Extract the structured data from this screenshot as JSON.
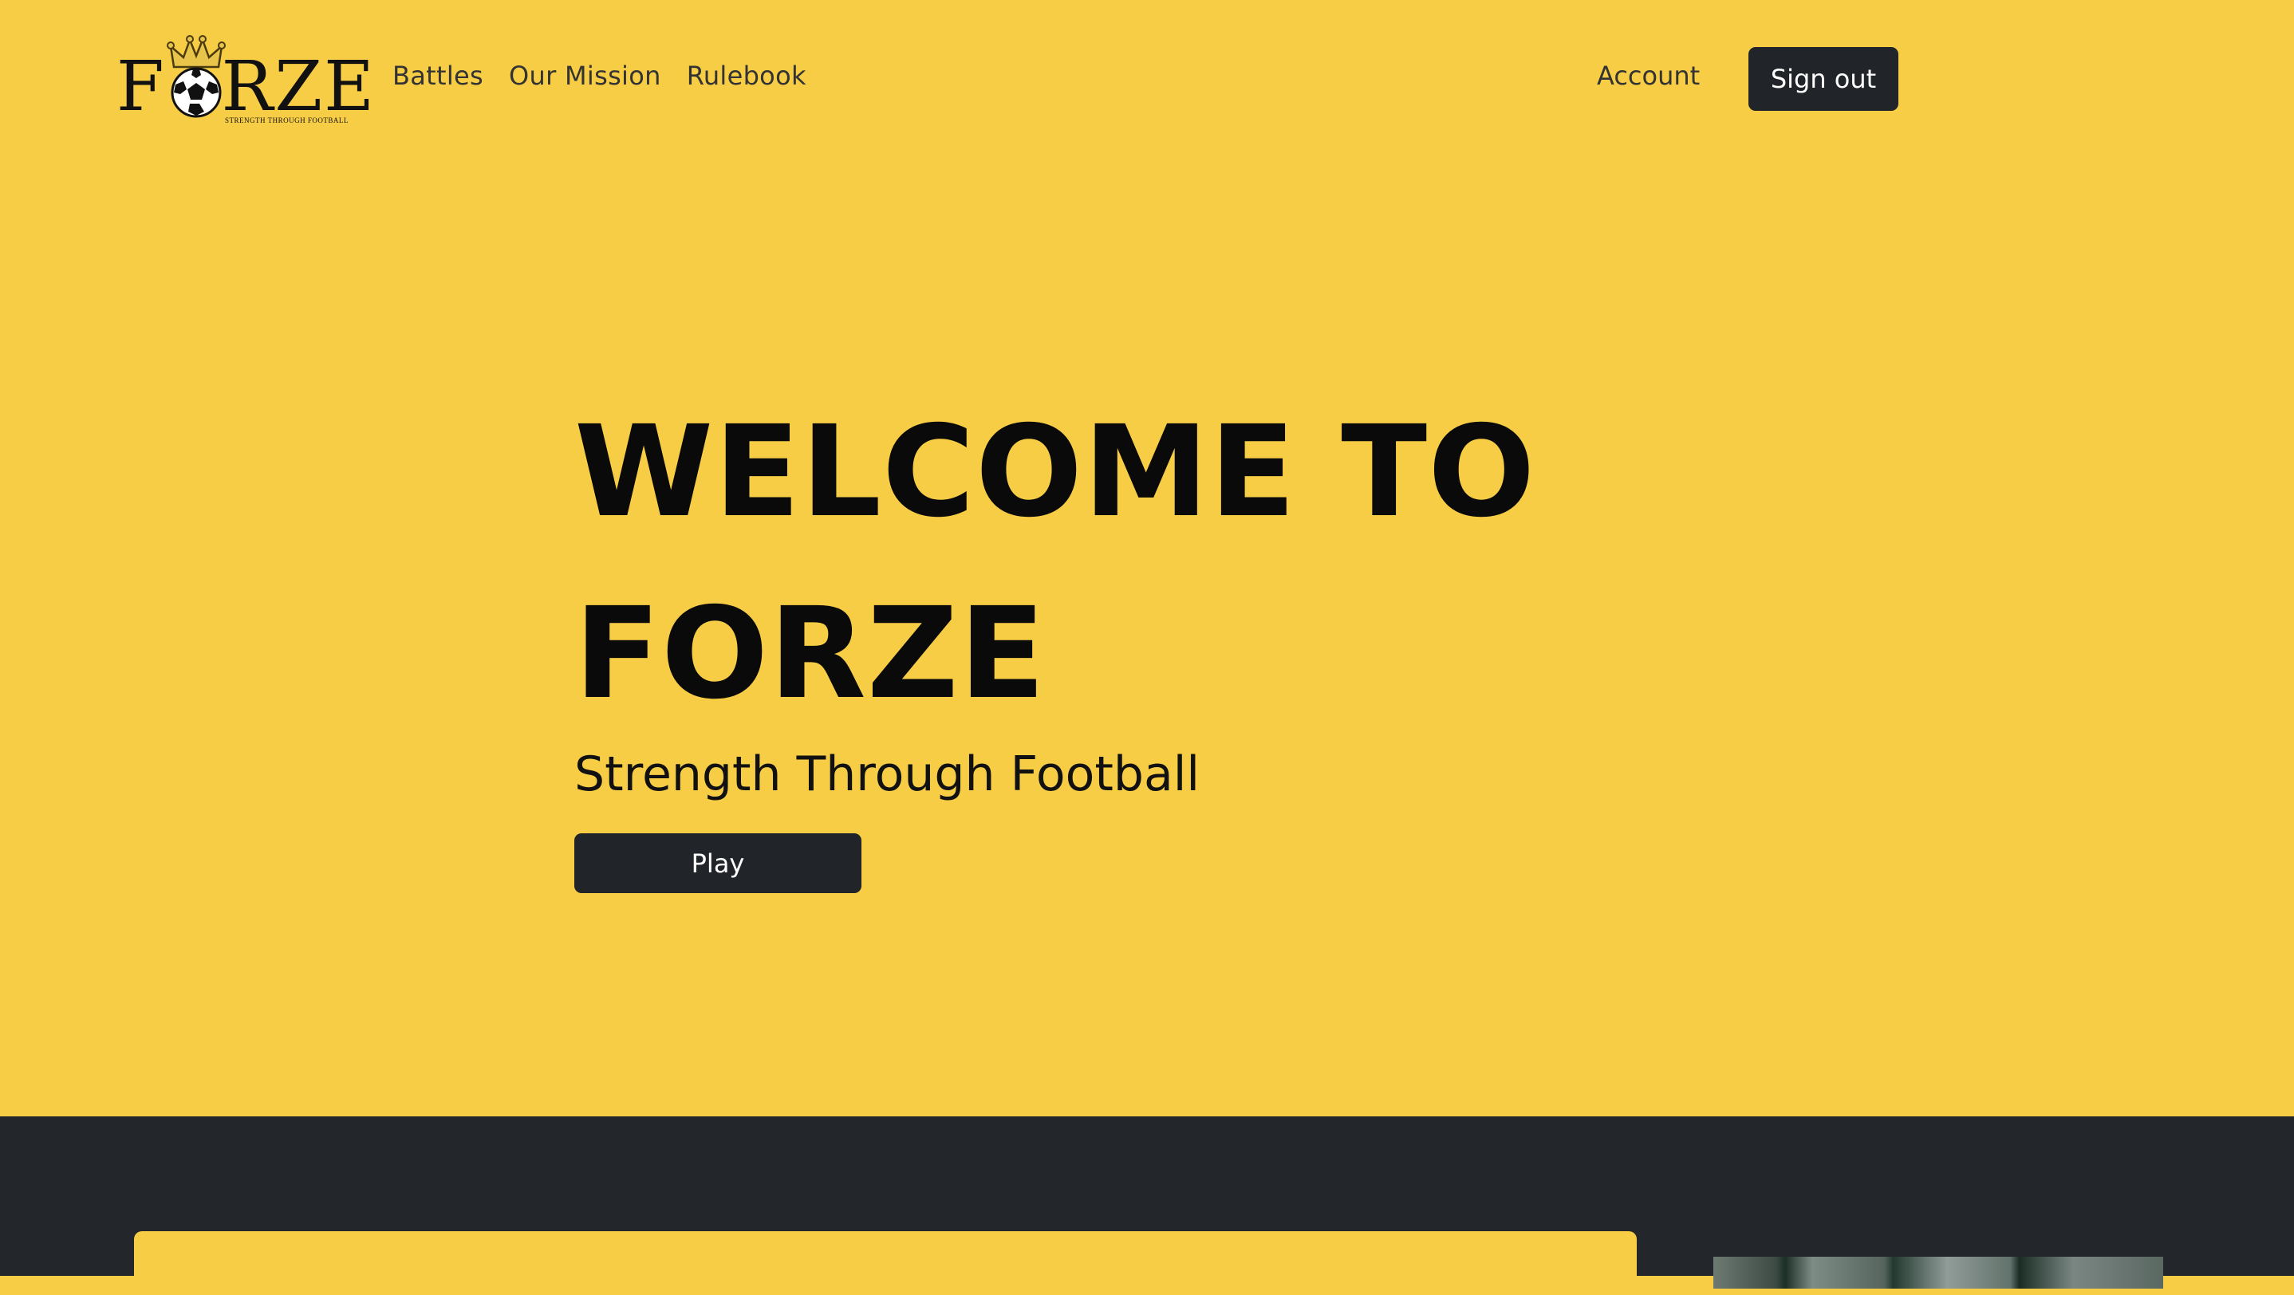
{
  "brand": {
    "logo_text_left": "F",
    "logo_text_right": "RZE",
    "tagline": "STRENGTH THROUGH FOOTBALL",
    "emblem_icon": "crowned-football-icon"
  },
  "nav": {
    "links": [
      {
        "label": "Battles"
      },
      {
        "label": "Our Mission"
      },
      {
        "label": "Rulebook"
      }
    ],
    "account_label": "Account",
    "signout_label": "Sign out"
  },
  "hero": {
    "title": "WELCOME TO FORZE",
    "subtitle": "Strength Through Football",
    "play_label": "Play"
  },
  "colors": {
    "accent": "#f7cd45",
    "dark": "#212529",
    "section_dark": "#23272b"
  }
}
